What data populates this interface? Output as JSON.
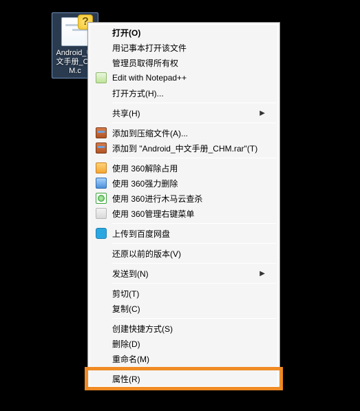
{
  "desktop": {
    "file_name": "Android_中文手册_CHM.c"
  },
  "menu": {
    "open": "打开(O)",
    "open_notepad": "用记事本打开该文件",
    "admin_take": "管理员取得所有权",
    "edit_npp": "Edit with Notepad++",
    "open_with": "打开方式(H)...",
    "share": "共享(H)",
    "add_archive": "添加到压缩文件(A)...",
    "add_archive_named": "添加到 \"Android_中文手册_CHM.rar\"(T)",
    "q360_unlock": "使用 360解除占用",
    "q360_force_del": "使用 360强力删除",
    "q360_trojan": "使用 360进行木马云查杀",
    "q360_ctx": "使用 360管理右键菜单",
    "baidu_upload": "上传到百度网盘",
    "restore_prev": "还原以前的版本(V)",
    "send_to": "发送到(N)",
    "cut": "剪切(T)",
    "copy": "复制(C)",
    "shortcut": "创建快捷方式(S)",
    "delete": "删除(D)",
    "rename": "重命名(M)",
    "properties": "属性(R)"
  },
  "glyphs": {
    "submenu_arrow": "▶",
    "question": "?"
  }
}
